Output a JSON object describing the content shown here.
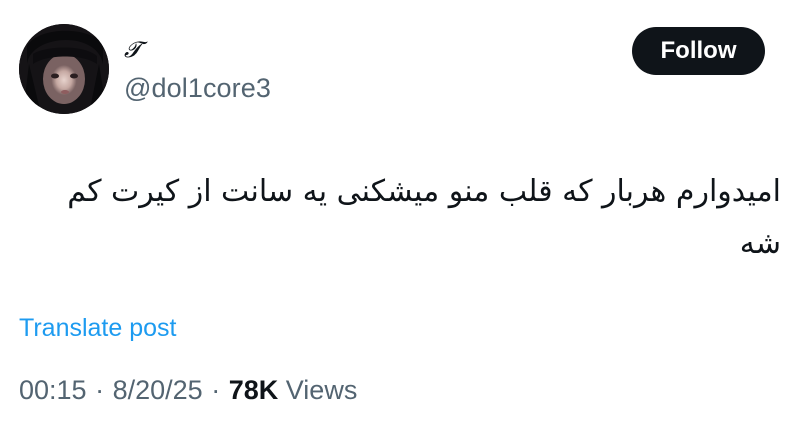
{
  "author": {
    "display_name": "𝓣",
    "handle": "@dol1core3"
  },
  "follow_label": "Follow",
  "tweet": {
    "text": "امیدوارم هربار که قلب منو میشکنی یه سانت از کیرت کم شه"
  },
  "translate_label": "Translate post",
  "meta": {
    "time": "00:15",
    "separator": "·",
    "date": "8/20/25",
    "views_count": "78K",
    "views_label": "Views"
  },
  "colors": {
    "text": "#0f1419",
    "secondary": "#536471",
    "link": "#1d9bf0",
    "button_bg": "#0f1419",
    "button_text": "#ffffff"
  }
}
